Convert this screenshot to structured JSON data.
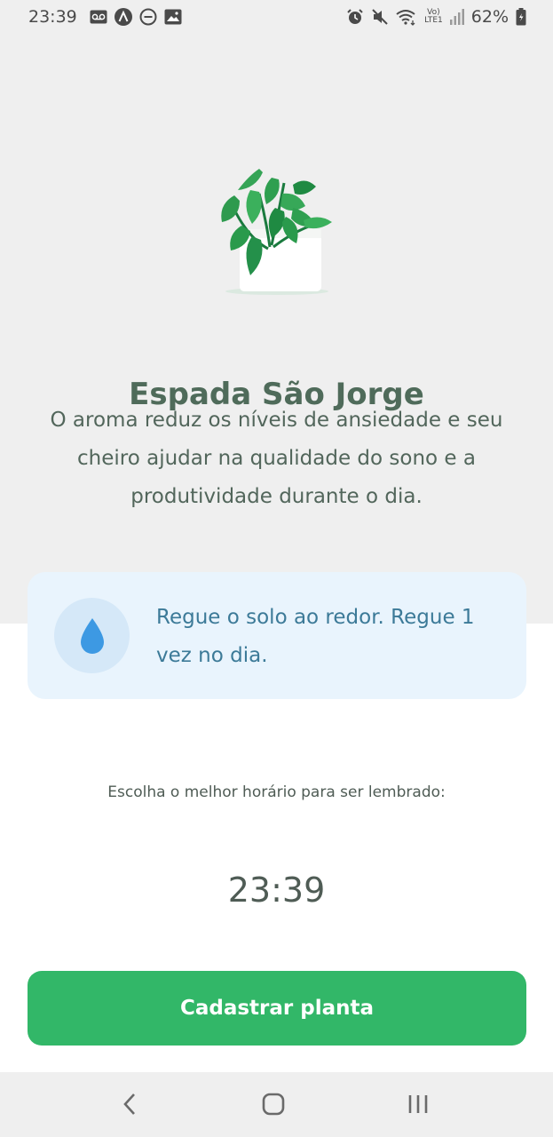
{
  "status_bar": {
    "time": "23:39",
    "battery": "62%",
    "network_top": "Vo)",
    "network_bottom": "LTE1",
    "icons": [
      "voicemail-icon",
      "a-circle-icon",
      "minus-circle-icon",
      "image-icon",
      "alarm-icon",
      "mute-icon",
      "wifi-icon",
      "signal-icon",
      "battery-icon"
    ]
  },
  "plant": {
    "name": "Espada São Jorge",
    "about": "O aroma reduz os níveis de ansiedade e seu cheiro ajudar na qualidade do sono e a produtividade durante o dia."
  },
  "tip": {
    "icon": "water-drop-icon",
    "text": "Regue o solo ao redor. Regue 1 vez no dia."
  },
  "reminder": {
    "label": "Escolha o melhor horário para ser lembrado:",
    "time": "23:39"
  },
  "button": {
    "label": "Cadastrar planta"
  },
  "nav": {
    "icons": [
      "back-icon",
      "home-icon",
      "recent-apps-icon"
    ]
  },
  "colors": {
    "accent": "#32b768",
    "heading": "#4f6b5a",
    "tip_bg": "#e9f4fd",
    "tip_text": "#3c7a98",
    "drop": "#3d99e3"
  }
}
